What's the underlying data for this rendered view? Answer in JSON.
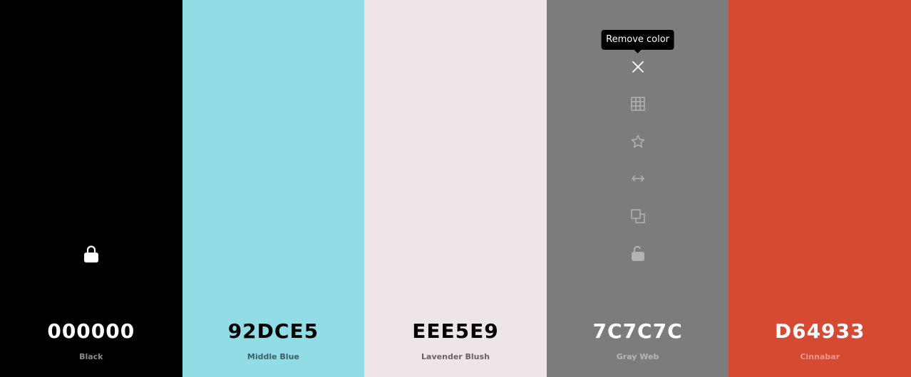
{
  "palette": [
    {
      "hex": "000000",
      "name": "Black",
      "bg": "#000000",
      "hex_color": "#ffffff",
      "name_color": "#8a8a8a",
      "locked": true
    },
    {
      "hex": "92DCE5",
      "name": "Middle Blue",
      "bg": "#92dce5",
      "hex_color": "#000000",
      "name_color": "#3e5e62",
      "locked": false
    },
    {
      "hex": "EEE5E9",
      "name": "Lavender Blush",
      "bg": "#eee5e9",
      "hex_color": "#000000",
      "name_color": "#666264",
      "locked": false
    },
    {
      "hex": "7C7C7C",
      "name": "Gray Web",
      "bg": "#7c7c7c",
      "hex_color": "#ffffff",
      "name_color": "#b8b8b8",
      "locked": false,
      "hovered": true
    },
    {
      "hex": "D64933",
      "name": "Cinnabar",
      "bg": "#d64933",
      "hex_color": "#ffffff",
      "name_color": "#e89c90",
      "locked": false
    }
  ],
  "hover_toolbar": {
    "tooltip": "Remove color",
    "icons": [
      "close-icon",
      "grid-icon",
      "star-icon",
      "arrows-horizontal-icon",
      "copy-icon",
      "lock-open-icon"
    ],
    "icon_color": "#b3b3b3",
    "active_icon_color": "#ffffff"
  }
}
